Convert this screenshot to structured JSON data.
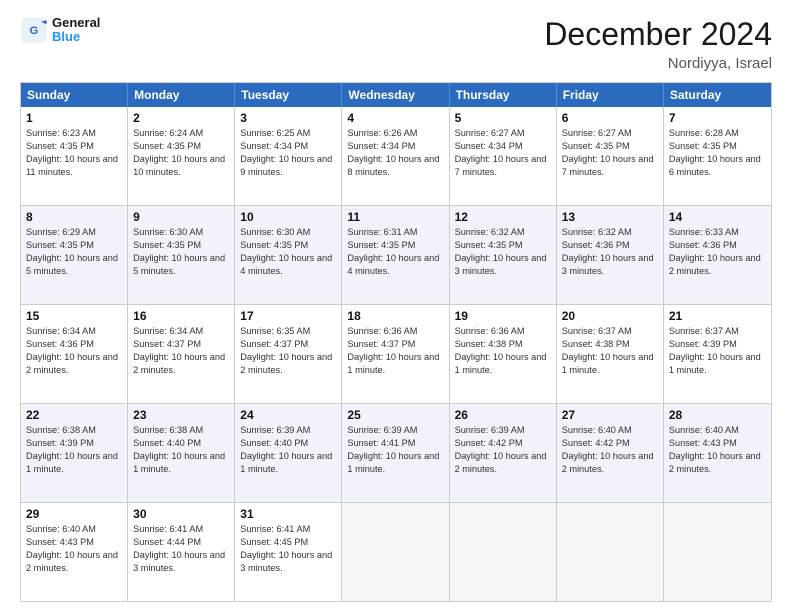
{
  "logo": {
    "text_general": "General",
    "text_blue": "Blue"
  },
  "header": {
    "month": "December 2024",
    "location": "Nordiyya, Israel"
  },
  "days": [
    "Sunday",
    "Monday",
    "Tuesday",
    "Wednesday",
    "Thursday",
    "Friday",
    "Saturday"
  ],
  "rows": [
    [
      {
        "day": "1",
        "rise": "6:23 AM",
        "set": "4:35 PM",
        "daylight": "10 hours and 11 minutes."
      },
      {
        "day": "2",
        "rise": "6:24 AM",
        "set": "4:35 PM",
        "daylight": "10 hours and 10 minutes."
      },
      {
        "day": "3",
        "rise": "6:25 AM",
        "set": "4:34 PM",
        "daylight": "10 hours and 9 minutes."
      },
      {
        "day": "4",
        "rise": "6:26 AM",
        "set": "4:34 PM",
        "daylight": "10 hours and 8 minutes."
      },
      {
        "day": "5",
        "rise": "6:27 AM",
        "set": "4:34 PM",
        "daylight": "10 hours and 7 minutes."
      },
      {
        "day": "6",
        "rise": "6:27 AM",
        "set": "4:35 PM",
        "daylight": "10 hours and 7 minutes."
      },
      {
        "day": "7",
        "rise": "6:28 AM",
        "set": "4:35 PM",
        "daylight": "10 hours and 6 minutes."
      }
    ],
    [
      {
        "day": "8",
        "rise": "6:29 AM",
        "set": "4:35 PM",
        "daylight": "10 hours and 5 minutes."
      },
      {
        "day": "9",
        "rise": "6:30 AM",
        "set": "4:35 PM",
        "daylight": "10 hours and 5 minutes."
      },
      {
        "day": "10",
        "rise": "6:30 AM",
        "set": "4:35 PM",
        "daylight": "10 hours and 4 minutes."
      },
      {
        "day": "11",
        "rise": "6:31 AM",
        "set": "4:35 PM",
        "daylight": "10 hours and 4 minutes."
      },
      {
        "day": "12",
        "rise": "6:32 AM",
        "set": "4:35 PM",
        "daylight": "10 hours and 3 minutes."
      },
      {
        "day": "13",
        "rise": "6:32 AM",
        "set": "4:36 PM",
        "daylight": "10 hours and 3 minutes."
      },
      {
        "day": "14",
        "rise": "6:33 AM",
        "set": "4:36 PM",
        "daylight": "10 hours and 2 minutes."
      }
    ],
    [
      {
        "day": "15",
        "rise": "6:34 AM",
        "set": "4:36 PM",
        "daylight": "10 hours and 2 minutes."
      },
      {
        "day": "16",
        "rise": "6:34 AM",
        "set": "4:37 PM",
        "daylight": "10 hours and 2 minutes."
      },
      {
        "day": "17",
        "rise": "6:35 AM",
        "set": "4:37 PM",
        "daylight": "10 hours and 2 minutes."
      },
      {
        "day": "18",
        "rise": "6:36 AM",
        "set": "4:37 PM",
        "daylight": "10 hours and 1 minute."
      },
      {
        "day": "19",
        "rise": "6:36 AM",
        "set": "4:38 PM",
        "daylight": "10 hours and 1 minute."
      },
      {
        "day": "20",
        "rise": "6:37 AM",
        "set": "4:38 PM",
        "daylight": "10 hours and 1 minute."
      },
      {
        "day": "21",
        "rise": "6:37 AM",
        "set": "4:39 PM",
        "daylight": "10 hours and 1 minute."
      }
    ],
    [
      {
        "day": "22",
        "rise": "6:38 AM",
        "set": "4:39 PM",
        "daylight": "10 hours and 1 minute."
      },
      {
        "day": "23",
        "rise": "6:38 AM",
        "set": "4:40 PM",
        "daylight": "10 hours and 1 minute."
      },
      {
        "day": "24",
        "rise": "6:39 AM",
        "set": "4:40 PM",
        "daylight": "10 hours and 1 minute."
      },
      {
        "day": "25",
        "rise": "6:39 AM",
        "set": "4:41 PM",
        "daylight": "10 hours and 1 minute."
      },
      {
        "day": "26",
        "rise": "6:39 AM",
        "set": "4:42 PM",
        "daylight": "10 hours and 2 minutes."
      },
      {
        "day": "27",
        "rise": "6:40 AM",
        "set": "4:42 PM",
        "daylight": "10 hours and 2 minutes."
      },
      {
        "day": "28",
        "rise": "6:40 AM",
        "set": "4:43 PM",
        "daylight": "10 hours and 2 minutes."
      }
    ],
    [
      {
        "day": "29",
        "rise": "6:40 AM",
        "set": "4:43 PM",
        "daylight": "10 hours and 2 minutes."
      },
      {
        "day": "30",
        "rise": "6:41 AM",
        "set": "4:44 PM",
        "daylight": "10 hours and 3 minutes."
      },
      {
        "day": "31",
        "rise": "6:41 AM",
        "set": "4:45 PM",
        "daylight": "10 hours and 3 minutes."
      },
      null,
      null,
      null,
      null
    ]
  ],
  "row_alt": [
    false,
    true,
    false,
    true,
    false
  ]
}
